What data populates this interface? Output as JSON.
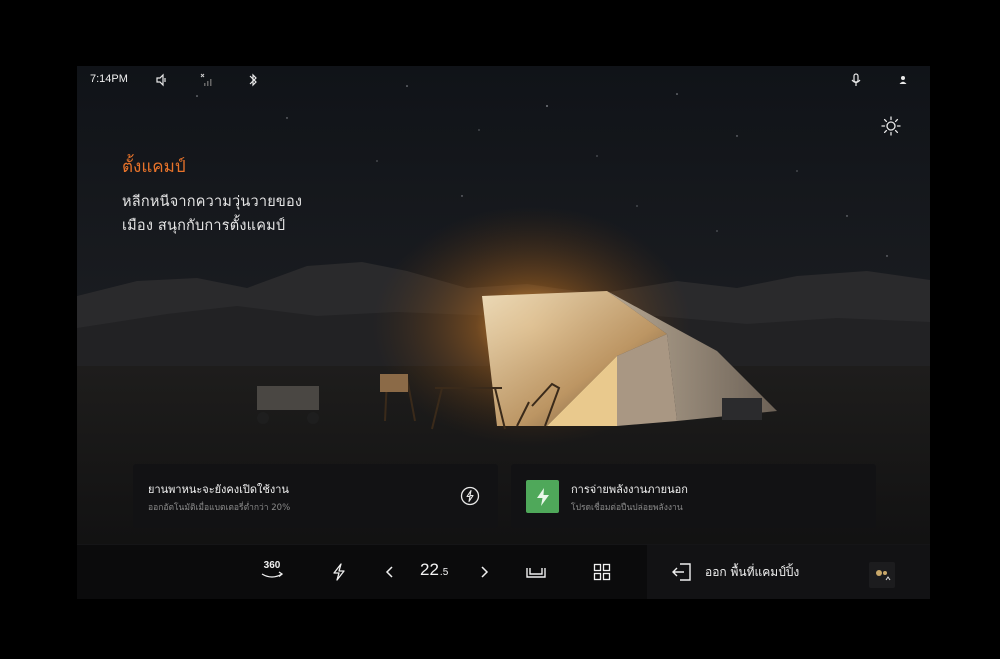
{
  "status_bar": {
    "time": "7:14PM",
    "icons": [
      "speaker-icon",
      "signal-icon",
      "bluetooth-icon",
      "microphone-icon",
      "user-icon"
    ]
  },
  "hero": {
    "title": "ตั้งแคมป์",
    "description_line1": "หลีกหนีจากความวุ่นวายของ",
    "description_line2": "เมือง สนุกกับการตั้งแคมป์",
    "weather_icon": "sun-settings-icon"
  },
  "cards": {
    "vehicle": {
      "title": "ยานพาหนะจะยังคงเปิดใช้งาน",
      "subtitle": "ออกอัตโนมัติเมื่อแบตเตอรี่ต่ำกว่า 20%",
      "icon": "bolt-circle-icon"
    },
    "power": {
      "title": "การจ่ายพลังงานภายนอก",
      "subtitle": "โปรดเชื่อมต่อปืนปล่อยพลังงาน",
      "icon": "battery-bolt-icon",
      "accent": "#4fa85a"
    }
  },
  "dock": {
    "view_360_label": "360",
    "temperature_whole": "22",
    "temperature_decimal": ".5",
    "exit_label": "ออก พื้นที่แคมป์ปิ้ง",
    "icons": [
      "360-view-icon",
      "lightning-icon",
      "chevron-left-icon",
      "chevron-right-icon",
      "seat-icon",
      "apps-grid-icon",
      "exit-icon"
    ]
  },
  "colors": {
    "accent_orange": "#e8732a",
    "card_bg": "#121214",
    "dock_bg": "#0b0b0c"
  }
}
